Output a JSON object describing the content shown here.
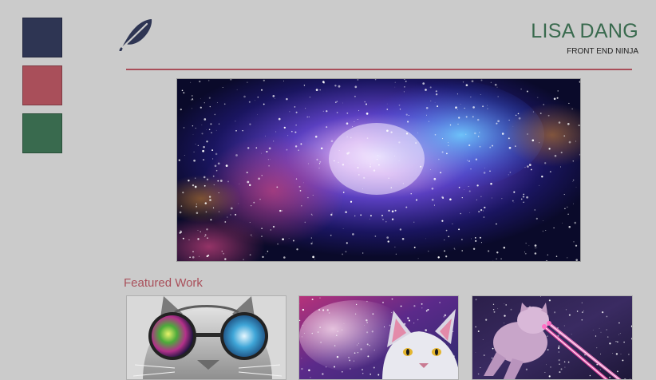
{
  "colors": {
    "navy": "#2e3553",
    "rose": "#a94f5a",
    "green": "#396a4e",
    "background": "#cbcbcb"
  },
  "swatches": [
    {
      "name": "navy",
      "color": "#2e3553"
    },
    {
      "name": "rose",
      "color": "#a94f5a"
    },
    {
      "name": "green",
      "color": "#396a4e"
    }
  ],
  "header": {
    "logo_icon": "feather-icon",
    "name": "LISA DANG",
    "tagline": "FRONT END NINJA"
  },
  "hero": {
    "image": "galaxy-nebula"
  },
  "featured": {
    "heading": "Featured Work",
    "items": [
      {
        "image": "cat-with-galaxy-glasses"
      },
      {
        "image": "cat-in-space"
      },
      {
        "image": "cat-shooting-lasers"
      }
    ]
  }
}
